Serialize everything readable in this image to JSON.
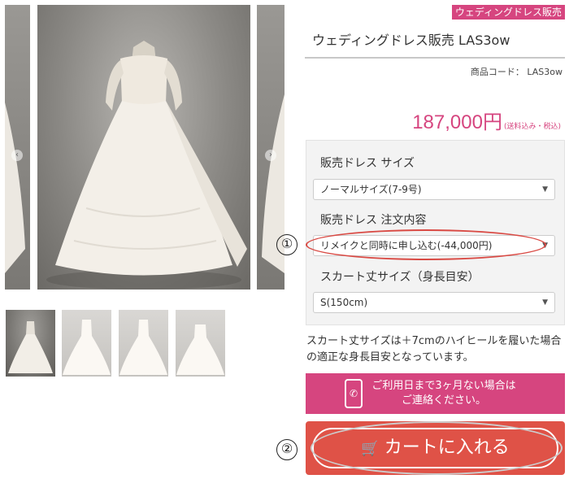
{
  "gallery": {
    "prev_label": "‹",
    "next_label": "›",
    "main_image": "wedding-dress-front",
    "thumbnails": [
      "dress-front",
      "dress-back",
      "dress-side",
      "dress-strapless"
    ]
  },
  "product": {
    "badge": "ウェディングドレス販売",
    "title": "ウェディングドレス販売 LAS3ow",
    "code": "商品コード： LAS3ow",
    "price": "187,000円",
    "tax_note": "(送料込み・税込)"
  },
  "options": {
    "size_label": "販売ドレス サイズ",
    "size_value": "ノーマルサイズ(7-9号)",
    "order_label": "販売ドレス 注文内容",
    "order_value": "リメイクと同時に申し込む(-44,000円)",
    "skirt_label": "スカート丈サイズ（身長目安）",
    "skirt_value": "S(150cm)"
  },
  "annotations": {
    "marker1": "①",
    "marker2": "②"
  },
  "note": "スカート丈サイズは＋7cmのハイヒールを履いた場合の適正な身長目安となっています。",
  "contact": {
    "line1": "ご利用日まで3ヶ月ない場合は",
    "line2": "ご連絡ください。"
  },
  "cart": {
    "label": "カートに入れる"
  },
  "colors": {
    "accent_pink": "#d6457f",
    "cart_red": "#df5247",
    "annotation_red": "#d94a44"
  }
}
